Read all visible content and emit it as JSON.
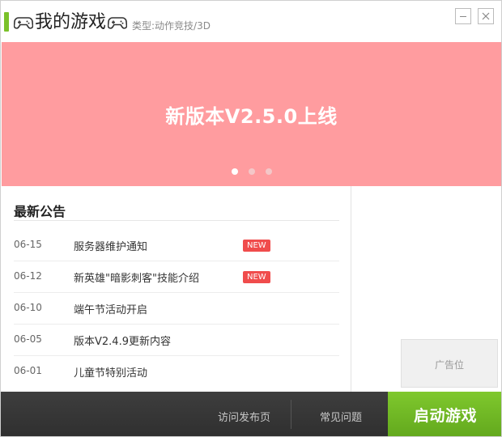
{
  "header": {
    "title": "我的游戏",
    "category": "类型:动作竞技/3D",
    "accent_color": "#7bc12a",
    "icons": [
      "gamepad-icon",
      "gamepad-icon"
    ]
  },
  "banner": {
    "title": "新版本V2.5.0上线",
    "background_color": "#ff9c9f",
    "dots_count": 3,
    "active_dot": 0
  },
  "notices": {
    "title": "最新公告",
    "items": [
      {
        "date": "06-15",
        "text": "服务器维护通知",
        "badge": "NEW"
      },
      {
        "date": "06-12",
        "text": "新英雄\"暗影刺客\"技能介绍",
        "badge": "NEW"
      },
      {
        "date": "06-10",
        "text": "端午节活动开启",
        "badge": ""
      },
      {
        "date": "06-05",
        "text": "版本V2.4.9更新内容",
        "badge": ""
      },
      {
        "date": "06-01",
        "text": "儿童节特别活动",
        "badge": ""
      }
    ]
  },
  "ad": {
    "label": "广告位"
  },
  "footer": {
    "link_release": "访问发布页",
    "link_faq": "常见问题",
    "start_label": "启动游戏",
    "start_color": "#6ab521"
  }
}
